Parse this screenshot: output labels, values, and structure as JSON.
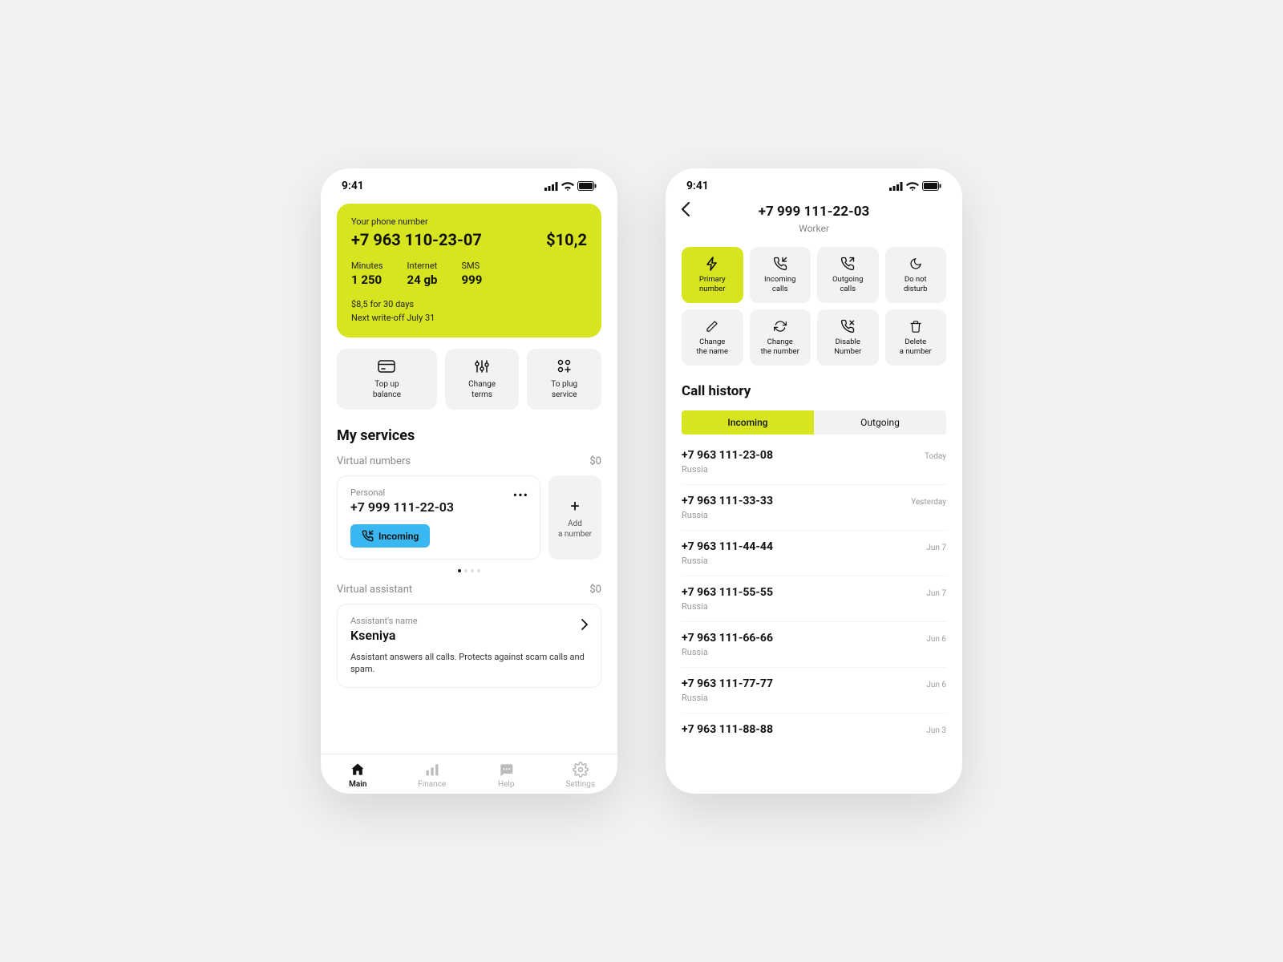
{
  "statusTime": "9:41",
  "screen1": {
    "card": {
      "label": "Your phone number",
      "phone": "+7 963 110-23-07",
      "balance": "$10,2",
      "stats": [
        {
          "label": "Minutes",
          "value": "1 250"
        },
        {
          "label": "Internet",
          "value": "24 gb"
        },
        {
          "label": "SMS",
          "value": "999"
        }
      ],
      "footer1": "$8,5 for 30 days",
      "footer2": "Next write-off July 31"
    },
    "actions": [
      {
        "label": "Top up\nbalance"
      },
      {
        "label": "Change\nterms"
      },
      {
        "label": "To plug\nservice"
      }
    ],
    "sectionTitle": "My services",
    "virtualNumbersLabel": "Virtual numbers",
    "virtualNumbersPrice": "$0",
    "vcard": {
      "label": "Personal",
      "number": "+7 999 111-22-03",
      "tag": "Incoming"
    },
    "addNumber": "Add\na number",
    "virtualAssistantLabel": "Virtual assistant",
    "virtualAssistantPrice": "$0",
    "assistant": {
      "label": "Assistant's name",
      "name": "Kseniya",
      "desc": "Assistant answers all calls. Protects against scam calls and spam."
    },
    "tabs": [
      {
        "label": "Main"
      },
      {
        "label": "Finance"
      },
      {
        "label": "Help"
      },
      {
        "label": "Settings"
      }
    ]
  },
  "screen2": {
    "title": "+7 999 111-22-03",
    "subtitle": "Worker",
    "actions": [
      {
        "label": "Primary\nnumber",
        "active": true
      },
      {
        "label": "Incoming\ncalls"
      },
      {
        "label": "Outgoing\ncalls"
      },
      {
        "label": "Do not\ndisturb"
      },
      {
        "label": "Change\nthe name"
      },
      {
        "label": "Change\nthe number"
      },
      {
        "label": "Disable\nNumber"
      },
      {
        "label": "Delete\na number"
      }
    ],
    "historyTitle": "Call history",
    "segments": [
      {
        "label": "Incoming",
        "active": true
      },
      {
        "label": "Outgoing"
      }
    ],
    "calls": [
      {
        "number": "+7 963 111-23-08",
        "country": "Russia",
        "date": "Today"
      },
      {
        "number": "+7 963 111-33-33",
        "country": "Russia",
        "date": "Yesterday"
      },
      {
        "number": "+7 963 111-44-44",
        "country": "Russia",
        "date": "Jun 7"
      },
      {
        "number": "+7 963 111-55-55",
        "country": "Russia",
        "date": "Jun 7"
      },
      {
        "number": "+7 963 111-66-66",
        "country": "Russia",
        "date": "Jun 6"
      },
      {
        "number": "+7 963 111-77-77",
        "country": "Russia",
        "date": "Jun 6"
      },
      {
        "number": "+7 963 111-88-88",
        "country": "",
        "date": "Jun 3"
      }
    ]
  }
}
